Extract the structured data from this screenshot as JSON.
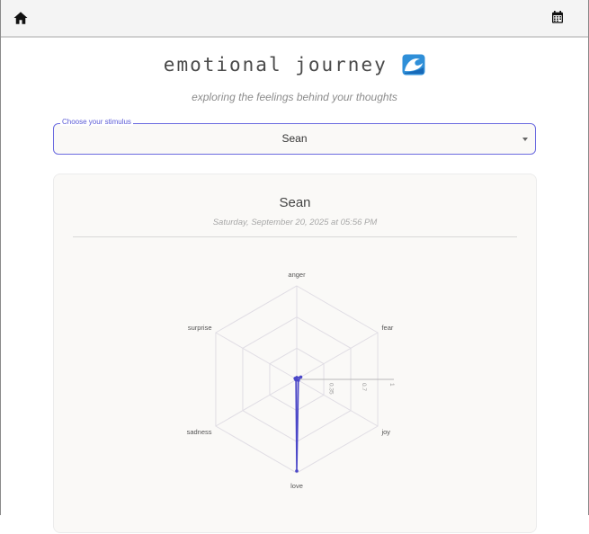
{
  "topbar": {
    "home_icon": "home-icon",
    "calendar_icon": "calendar-icon"
  },
  "header": {
    "title": "emotional journey",
    "title_icon": "wave-emoji-icon",
    "subtitle": "exploring the feelings behind your thoughts"
  },
  "stimulus_select": {
    "label": "Choose your stimulus",
    "value": "Sean"
  },
  "entry": {
    "title": "Sean",
    "date": "Saturday, September 20, 2025 at 05:56 PM"
  },
  "colors": {
    "accent": "#5a5ad6",
    "series": "#4b47c8",
    "grid": "#e0dde4"
  },
  "chart_data": {
    "type": "radar",
    "axes": [
      "anger",
      "fear",
      "joy",
      "love",
      "sadness",
      "surprise"
    ],
    "radial_ticks": [
      "0.35",
      "0.7",
      "1"
    ],
    "rlim": [
      0,
      1
    ],
    "series": [
      {
        "values": [
          0.02,
          0.05,
          0.02,
          0.98,
          0.01,
          0.02
        ]
      }
    ]
  }
}
